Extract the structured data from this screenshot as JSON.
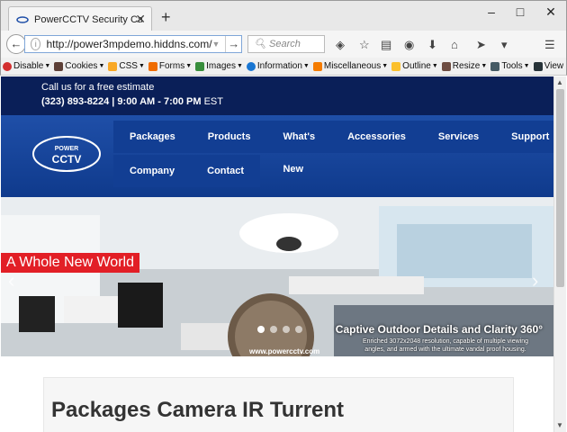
{
  "browser": {
    "tab_title": "PowerCCTV Security Cam...",
    "new_tab": "+",
    "window_controls": [
      "–",
      "□",
      "✕"
    ],
    "url": "http://power3mpdemo.hiddns.com/",
    "search_placeholder": "Search",
    "icons": [
      "back-icon",
      "info-icon",
      "dropdown-icon",
      "go-icon",
      "search-icon",
      "extension-icon",
      "bookmark-star-icon",
      "reading-list-icon",
      "pocket-icon",
      "download-icon",
      "home-icon",
      "send-icon",
      "more-icon",
      "menu-icon"
    ]
  },
  "devtoolbar": {
    "items": [
      {
        "label": "Disable",
        "color": "#d32f2f"
      },
      {
        "label": "Cookies",
        "color": "#5d4037"
      },
      {
        "label": "CSS",
        "color": "#f9a825"
      },
      {
        "label": "Forms",
        "color": "#ef6c00"
      },
      {
        "label": "Images",
        "color": "#388e3c"
      },
      {
        "label": "Information",
        "color": "#1976d2"
      },
      {
        "label": "Miscellaneous",
        "color": "#f57c00"
      },
      {
        "label": "Outline",
        "color": "#fbc02d"
      },
      {
        "label": "Resize",
        "color": "#6d4c41"
      },
      {
        "label": "Tools",
        "color": "#455a64"
      },
      {
        "label": "View Source",
        "color": "#263238"
      }
    ]
  },
  "site": {
    "call_line": "Call us for a free estimate",
    "hours_line": "(323) 893-8224  |  9:00 AM - 7:00 PM",
    "hours_tz": "EST",
    "logo_text_top": "POWER",
    "logo_text_bottom": "CCTV",
    "menu_row1": [
      "Packages",
      "Products",
      "What's New",
      "Accessories",
      "Services",
      "Support"
    ],
    "menu_row2": [
      "Company",
      "Contact"
    ],
    "hero_badge": "A Whole New World",
    "hero_caption": "Captive Outdoor Details and Clarity 360°",
    "hero_subcaption": "Enriched 3072x2048 resolution, capable of  multiple viewing angles, and armed with  the ultimate vandal proof housing.",
    "hero_website": "www.powercctv.com",
    "page_heading": "Packages Camera IR Turrent"
  },
  "colors": {
    "top_strip": "#0a1f58",
    "nav_band": "#1f4fa8",
    "badge": "#e21f26"
  }
}
